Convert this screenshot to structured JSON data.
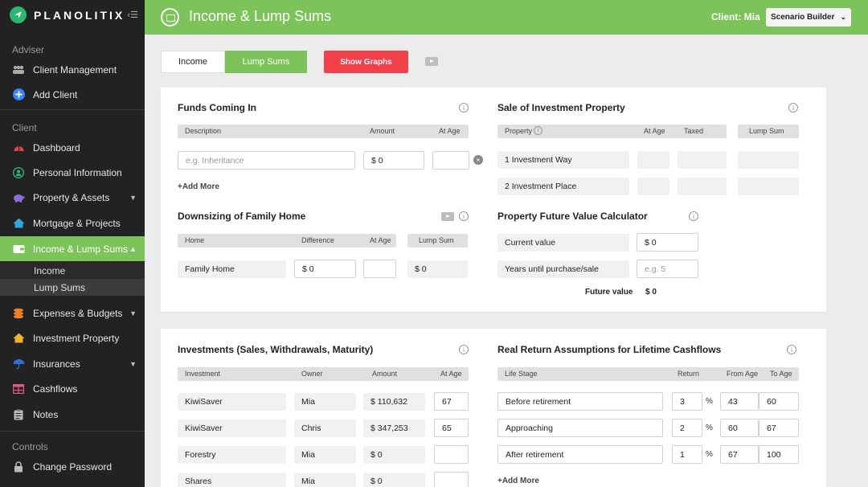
{
  "brand": {
    "name": "PLANOLITIX"
  },
  "sidebar": {
    "adviser_label": "Adviser",
    "adviser_items": [
      {
        "label": "Client Management",
        "icon": "people-icon"
      },
      {
        "label": "Add Client",
        "icon": "plus-circle-icon"
      }
    ],
    "client_label": "Client",
    "client_items": [
      {
        "label": "Dashboard",
        "icon": "gauge-icon"
      },
      {
        "label": "Personal Information",
        "icon": "person-icon"
      },
      {
        "label": "Property & Assets",
        "icon": "piggy-bank-icon"
      },
      {
        "label": "Mortgage & Projects",
        "icon": "house-icon"
      },
      {
        "label": "Income & Lump Sums",
        "icon": "wallet-icon"
      },
      {
        "label": "Expenses & Budgets",
        "icon": "coins-icon"
      },
      {
        "label": "Investment Property",
        "icon": "property-house-icon"
      },
      {
        "label": "Insurances",
        "icon": "umbrella-icon"
      },
      {
        "label": "Cashflows",
        "icon": "grid-icon"
      },
      {
        "label": "Notes",
        "icon": "clipboard-icon"
      }
    ],
    "sub_items": [
      "Income",
      "Lump Sums"
    ],
    "controls_label": "Controls",
    "controls_items": [
      {
        "label": "Change Password",
        "icon": "lock-icon"
      }
    ]
  },
  "topbar": {
    "title": "Income & Lump Sums",
    "client": "Client: Mia",
    "scenario": "Scenario Builder"
  },
  "tabs": {
    "income": "Income",
    "lump_sums": "Lump Sums",
    "show_graphs": "Show Graphs"
  },
  "funds": {
    "title": "Funds Coming In",
    "headers": {
      "description": "Description",
      "amount": "Amount",
      "at_age": "At Age"
    },
    "desc_placeholder": "e.g. Inheritance",
    "amount": "$ 0",
    "add_more": "+Add More"
  },
  "sale": {
    "title": "Sale of Investment Property",
    "headers": {
      "property": "Property",
      "at_age": "At Age",
      "taxed": "Taxed",
      "lump_sum": "Lump Sum"
    },
    "rows": [
      "1 Investment Way",
      "2 Investment Place"
    ]
  },
  "downsizing": {
    "title": "Downsizing of Family Home",
    "headers": {
      "home": "Home",
      "difference": "Difference",
      "at_age": "At Age",
      "lump_sum": "Lump Sum"
    },
    "row": {
      "home": "Family Home",
      "difference": "$ 0",
      "lump_sum": "$ 0"
    }
  },
  "calculator": {
    "title": "Property Future Value Calculator",
    "current_label": "Current value",
    "current_value": "$ 0",
    "years_label": "Years until purchase/sale",
    "years_placeholder": "e.g. 5",
    "future_label": "Future value",
    "future_value": "$ 0"
  },
  "investments": {
    "title": "Investments (Sales, Withdrawals, Maturity)",
    "headers": {
      "investment": "Investment",
      "owner": "Owner",
      "amount": "Amount",
      "at_age": "At Age"
    },
    "rows": [
      {
        "investment": "KiwiSaver",
        "owner": "Mia",
        "amount": "$ 110,632",
        "age": "67"
      },
      {
        "investment": "KiwiSaver",
        "owner": "Chris",
        "amount": "$ 347,253",
        "age": "65"
      },
      {
        "investment": "Forestry",
        "owner": "Mia",
        "amount": "$ 0",
        "age": ""
      },
      {
        "investment": "Shares",
        "owner": "Mia",
        "amount": "$ 0",
        "age": ""
      }
    ]
  },
  "returns": {
    "title": "Real Return Assumptions for Lifetime Cashflows",
    "headers": {
      "life_stage": "Life Stage",
      "return": "Return",
      "from_age": "From Age",
      "to_age": "To Age"
    },
    "pct_symbol": "%",
    "rows": [
      {
        "stage": "Before retirement",
        "return": "3",
        "from": "43",
        "to": "60"
      },
      {
        "stage": "Approaching",
        "return": "2",
        "from": "60",
        "to": "67"
      },
      {
        "stage": "After retirement",
        "return": "1",
        "from": "67",
        "to": "100"
      }
    ],
    "add_more": "+Add More"
  },
  "colors": {
    "accent": "#7cc35a",
    "danger": "#f2404b",
    "sidebar": "#222222"
  }
}
